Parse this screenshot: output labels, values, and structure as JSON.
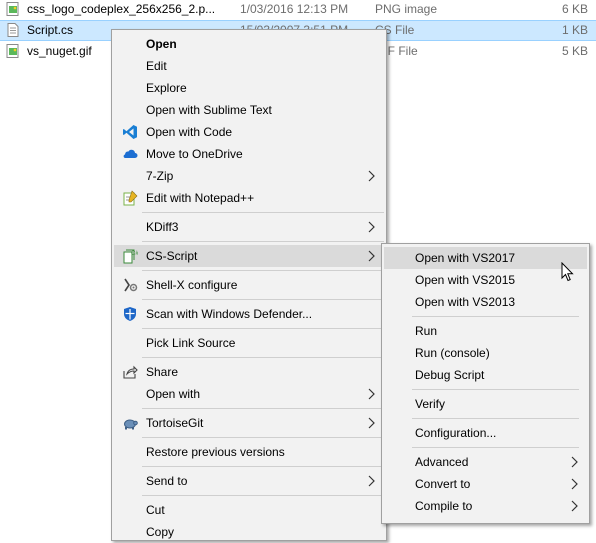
{
  "files": [
    {
      "name": "css_logo_codeplex_256x256_2.p...",
      "date": "1/03/2016 12:13 PM",
      "type": "PNG image",
      "size": "6 KB",
      "icon": "image-file-icon"
    },
    {
      "name": "Script.cs",
      "date": "15/03/2007 3:51 PM",
      "type": "CS File",
      "size": "1 KB",
      "icon": "text-file-icon"
    },
    {
      "name": "vs_nuget.gif",
      "date": "",
      "type": "GIF File",
      "size": "5 KB",
      "icon": "image-file-icon"
    }
  ],
  "context_menu": {
    "items": [
      {
        "label": "Open",
        "icon": ""
      },
      {
        "label": "Edit",
        "icon": ""
      },
      {
        "label": "Explore",
        "icon": ""
      },
      {
        "label": "Open with Sublime Text",
        "icon": ""
      },
      {
        "label": "Open with Code",
        "icon": "vscode-icon"
      },
      {
        "label": "Move to OneDrive",
        "icon": "onedrive-cloud-icon"
      },
      {
        "label": "7-Zip",
        "icon": ""
      },
      {
        "label": "Edit with Notepad++",
        "icon": "notepad-plus-plus-icon"
      },
      {
        "label": "KDiff3",
        "icon": ""
      },
      {
        "label": "CS-Script",
        "icon": "cs-script-icon"
      },
      {
        "label": "Shell-X configure",
        "icon": "shell-x-icon"
      },
      {
        "label": "Scan with Windows Defender...",
        "icon": "windows-defender-icon"
      },
      {
        "label": "Pick Link Source",
        "icon": ""
      },
      {
        "label": "Share",
        "icon": "share-icon"
      },
      {
        "label": "Open with",
        "icon": ""
      },
      {
        "label": "TortoiseGit",
        "icon": "tortoisegit-icon"
      },
      {
        "label": "Restore previous versions",
        "icon": ""
      },
      {
        "label": "Send to",
        "icon": ""
      },
      {
        "label": "Cut",
        "icon": ""
      },
      {
        "label": "Copy",
        "icon": ""
      }
    ]
  },
  "submenu": {
    "items": [
      {
        "label": "Open with VS2017"
      },
      {
        "label": "Open with VS2015"
      },
      {
        "label": "Open with VS2013"
      },
      {
        "label": "Run"
      },
      {
        "label": "Run (console)"
      },
      {
        "label": "Debug Script"
      },
      {
        "label": "Verify"
      },
      {
        "label": "Configuration..."
      },
      {
        "label": "Advanced"
      },
      {
        "label": "Convert to"
      },
      {
        "label": "Compile to"
      }
    ]
  },
  "colors": {
    "selection": "#cce8ff",
    "menu_background": "#f2f2f2",
    "menu_highlight": "#dadada"
  }
}
